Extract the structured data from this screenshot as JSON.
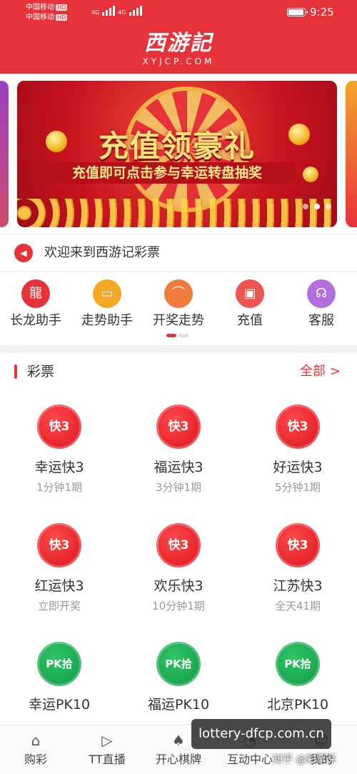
{
  "status_bar": {
    "carrier1": "中国移动",
    "carrier2": "中国移动",
    "hd": "HD",
    "net1": "4G",
    "net2": "4G",
    "time": "9:25",
    "battery_level": 0.95
  },
  "header": {
    "logo_cn": "西游記",
    "logo_en": "XYJCP.COM",
    "bg_color": "#e8323a"
  },
  "banner": {
    "title": "充值领豪礼",
    "subtitle": "充值即可点击参与幸运转盘抽奖",
    "slide_count": 3,
    "active_slide": 1
  },
  "notice": {
    "text": "欢迎来到西游记彩票",
    "icon": "speaker-icon"
  },
  "quick_actions": [
    {
      "label": "长龙助手",
      "icon": "dragon-icon",
      "color": "#e8323a",
      "glyph": "龍"
    },
    {
      "label": "走势助手",
      "icon": "tv-chart-icon",
      "color": "#f5a623",
      "glyph": "▭"
    },
    {
      "label": "开奖走势",
      "icon": "trend-chart-icon",
      "color": "#f27a3c",
      "glyph": "⌒"
    },
    {
      "label": "充值",
      "icon": "wallet-icon",
      "color": "#f0544f",
      "glyph": "▣"
    },
    {
      "label": "客服",
      "icon": "headset-icon",
      "color": "#b16fe0",
      "glyph": "☊"
    }
  ],
  "lottery": {
    "title": "彩票",
    "more": "全部 >",
    "games": [
      {
        "name": "幸运快3",
        "sub": "1分钟1期",
        "badge": "快3",
        "icon": "kuai3-icon",
        "kind": "red"
      },
      {
        "name": "福运快3",
        "sub": "3分钟1期",
        "badge": "快3",
        "icon": "kuai3-icon",
        "kind": "red"
      },
      {
        "name": "好运快3",
        "sub": "5分钟1期",
        "badge": "快3",
        "icon": "kuai3-icon",
        "kind": "red"
      },
      {
        "name": "红运快3",
        "sub": "立即开奖",
        "badge": "快3",
        "icon": "kuai3-icon",
        "kind": "red"
      },
      {
        "name": "欢乐快3",
        "sub": "10分钟1期",
        "badge": "快3",
        "icon": "kuai3-icon",
        "kind": "red"
      },
      {
        "name": "江苏快3",
        "sub": "全天41期",
        "badge": "快3",
        "icon": "kuai3-icon",
        "kind": "red"
      },
      {
        "name": "幸运PK10",
        "sub": "",
        "badge": "PK拾",
        "icon": "pk10-icon",
        "kind": "green"
      },
      {
        "name": "福运PK10",
        "sub": "",
        "badge": "PK拾",
        "icon": "pk10-icon",
        "kind": "green"
      },
      {
        "name": "北京PK10",
        "sub": "",
        "badge": "PK拾",
        "icon": "pk10-icon",
        "kind": "green"
      }
    ]
  },
  "tabbar": [
    {
      "label": "购彩",
      "icon": "home-icon",
      "glyph": "⌂"
    },
    {
      "label": "TT直播",
      "icon": "play-icon",
      "glyph": "▷"
    },
    {
      "label": "开心棋牌",
      "icon": "cards-icon",
      "glyph": "♠"
    },
    {
      "label": "互动中心",
      "icon": "chat-icon",
      "glyph": "◔"
    },
    {
      "label": "我的",
      "icon": "user-icon",
      "glyph": "☺"
    }
  ],
  "watermark": {
    "url": "lottery-dfcp.com.cn",
    "source": "知乎 @彩票深"
  }
}
